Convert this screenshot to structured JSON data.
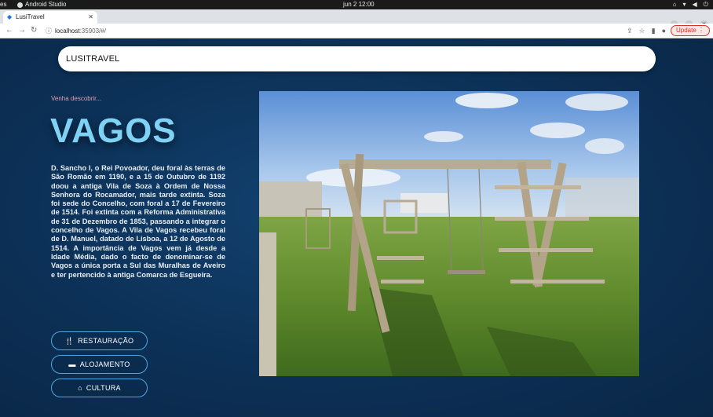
{
  "os": {
    "activities": "es",
    "app_name": "Android Studio",
    "clock": "jun 2  12:00"
  },
  "browser": {
    "tab_title": "LusiTravel",
    "url_host": "localhost",
    "url_path": ":35903/#/",
    "update_label": "Update"
  },
  "appbar": {
    "brand": "LUSITRAVEL"
  },
  "hero": {
    "kicker": "Venha descobrir...",
    "title": "VAGOS",
    "description": "D. Sancho I, o Rei Povoador, deu foral às terras de São Romão em 1190, e a 15 de Outubro de 1192 doou a antiga Vila de Soza à Ordem de Nossa Senhora do Rocamador, mais tarde extinta. Soza foi sede do Concelho, com foral a 17 de Fevereiro de 1514. Foi extinta com a Reforma Administrativa de 31 de Dezembro de 1853, passando a integrar o concelho de Vagos. A Vila de Vagos recebeu foral de D. Manuel, datado de Lisboa, a 12 de Agosto de 1514. A importância de Vagos vem já desde a Idade Média, dado o facto de denominar-se de Vagos a única porta a Sul das Muralhas de Aveiro e ter pertencido à antiga Comarca de Esgueira."
  },
  "categories": [
    {
      "label": "RESTAURAÇÃO",
      "icon": "restaurant-icon"
    },
    {
      "label": "ALOJAMENTO",
      "icon": "bed-icon"
    },
    {
      "label": "CULTURA",
      "icon": "museum-icon"
    }
  ],
  "colors": {
    "background": "#0c3056",
    "title": "#7fd2f4",
    "kicker": "#e79bb0",
    "button_border": "#4fa7e0"
  }
}
